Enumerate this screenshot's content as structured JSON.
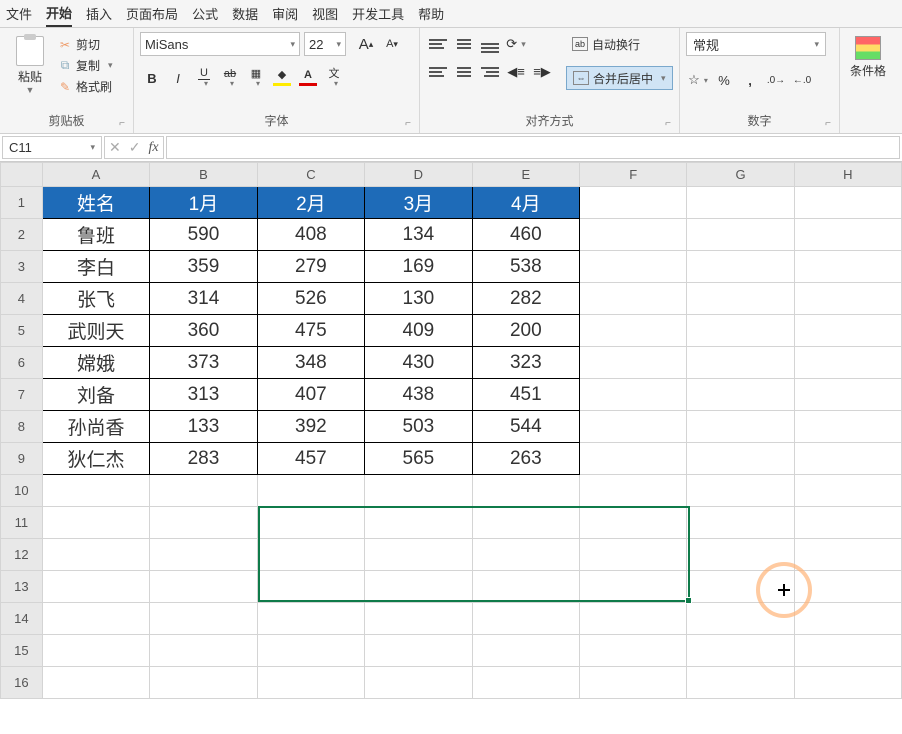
{
  "menu": {
    "items": [
      "文件",
      "开始",
      "插入",
      "页面布局",
      "公式",
      "数据",
      "审阅",
      "视图",
      "开发工具",
      "帮助"
    ],
    "active_index": 1
  },
  "ribbon": {
    "clipboard": {
      "paste": "粘贴",
      "cut": "剪切",
      "copy": "复制",
      "format_painter": "格式刷",
      "group_label": "剪贴板"
    },
    "font": {
      "font_name": "MiSans",
      "font_size": "22",
      "bold": "B",
      "italic": "I",
      "underline": "U",
      "dash": "ab",
      "wen": "文",
      "a_large": "A",
      "a_small": "A",
      "group_label": "字体"
    },
    "align": {
      "wrap": "自动换行",
      "merge": "合并后居中",
      "group_label": "对齐方式"
    },
    "number": {
      "format": "常规",
      "group_label": "数字"
    },
    "cond": {
      "label": "条件格"
    }
  },
  "formula_bar": {
    "name_box": "C11",
    "fx": "fx"
  },
  "sheet": {
    "col_headers": [
      "A",
      "B",
      "C",
      "D",
      "E",
      "F",
      "G",
      "H"
    ],
    "row_headers": [
      "1",
      "2",
      "3",
      "4",
      "5",
      "6",
      "7",
      "8",
      "9",
      "10",
      "11",
      "12",
      "13",
      "14",
      "15",
      "16"
    ],
    "header_row": [
      "姓名",
      "1月",
      "2月",
      "3月",
      "4月"
    ],
    "data": [
      [
        "鲁班",
        "590",
        "408",
        "134",
        "460"
      ],
      [
        "李白",
        "359",
        "279",
        "169",
        "538"
      ],
      [
        "张飞",
        "314",
        "526",
        "130",
        "282"
      ],
      [
        "武则天",
        "360",
        "475",
        "409",
        "200"
      ],
      [
        "嫦娥",
        "373",
        "348",
        "430",
        "323"
      ],
      [
        "刘备",
        "313",
        "407",
        "438",
        "451"
      ],
      [
        "孙尚香",
        "133",
        "392",
        "503",
        "544"
      ],
      [
        "狄仁杰",
        "283",
        "457",
        "565",
        "263"
      ]
    ],
    "selection": {
      "start": "C11",
      "end": "F13"
    }
  }
}
